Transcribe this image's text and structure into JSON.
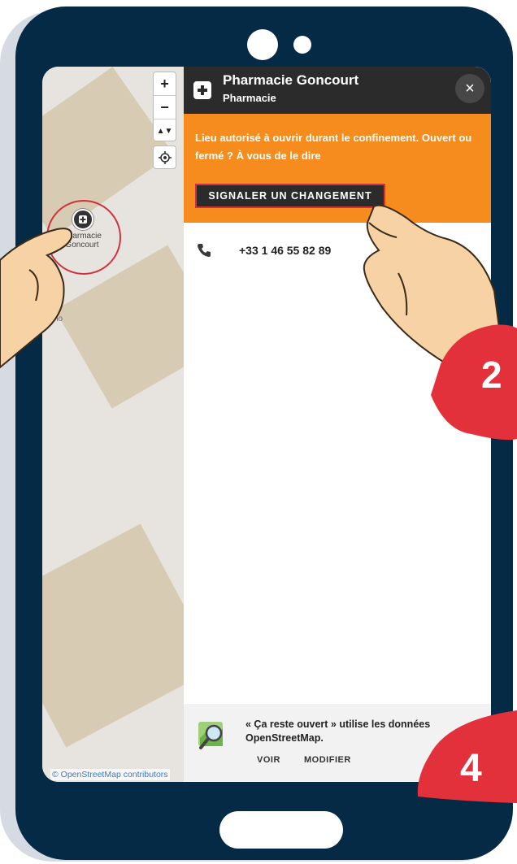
{
  "map": {
    "zoom_in": "+",
    "zoom_out": "−",
    "compass": "▲▼",
    "marker_label": "Pharmacie Goncourt",
    "fragment": "no",
    "attribution": "© OpenStreetMap contributors"
  },
  "panel": {
    "title": "Pharmacie Goncourt",
    "subtitle": "Pharmacie",
    "close": "×",
    "banner_text": "Lieu autorisé à ouvrir durant le confinement. Ouvert ou fermé ? À vous de le dire",
    "report_button": "SIGNALER UN CHANGEMENT",
    "phone": "+33 1 46 55 82 89",
    "footer_text": "« Ça reste ouvert » utilise les données OpenStreetMap.",
    "link_view": "VOIR",
    "link_edit": "MODIFIER"
  },
  "steps": {
    "step_2": "2",
    "step_4": "4"
  },
  "colors": {
    "phone_body": "#052a45",
    "banner": "#f68c1e",
    "header": "#2b2b2b",
    "highlight_red": "#d0313a",
    "badge_red": "#e2313a",
    "hand": "#f6d2a4"
  },
  "icons": [
    "pharmacy-cross-icon",
    "close-icon",
    "locate-icon",
    "phone-icon",
    "osm-magnifier-icon"
  ]
}
